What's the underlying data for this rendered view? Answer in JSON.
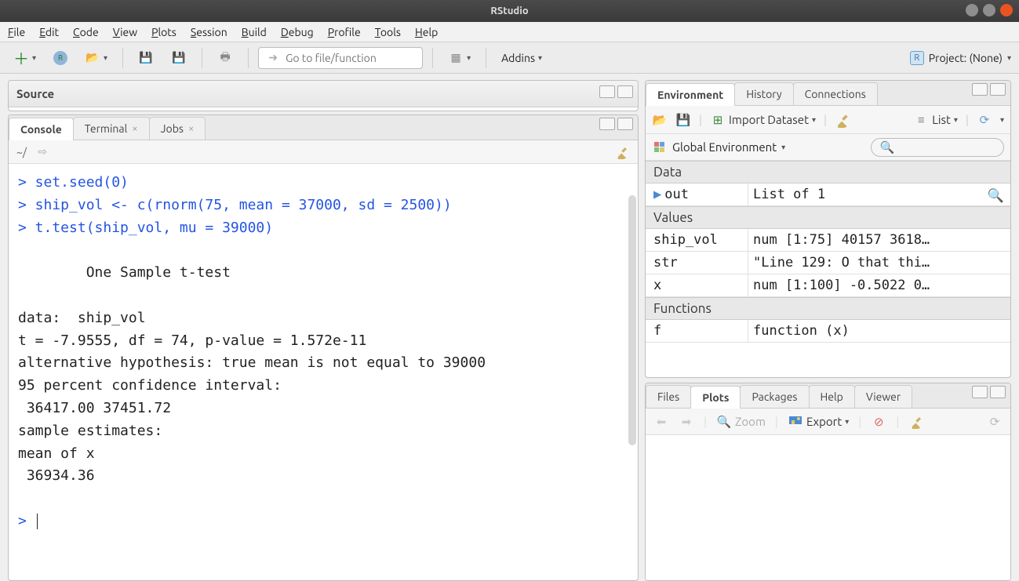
{
  "window": {
    "title": "RStudio"
  },
  "menubar": [
    "File",
    "Edit",
    "Code",
    "View",
    "Plots",
    "Session",
    "Build",
    "Debug",
    "Profile",
    "Tools",
    "Help"
  ],
  "toolbar": {
    "goto_placeholder": "Go to file/function",
    "addins_label": "Addins",
    "project_label": "Project: (None)"
  },
  "source_panel": {
    "title": "Source"
  },
  "console_panel": {
    "tabs": [
      {
        "label": "Console",
        "active": true,
        "closable": false
      },
      {
        "label": "Terminal",
        "active": false,
        "closable": true
      },
      {
        "label": "Jobs",
        "active": false,
        "closable": true
      }
    ],
    "cwd": "~/",
    "lines": [
      {
        "type": "cmd",
        "text": "> set.seed(0)"
      },
      {
        "type": "cmd",
        "text": "> ship_vol <- c(rnorm(75, mean = 37000, sd = 2500))"
      },
      {
        "type": "cmd",
        "text": "> t.test(ship_vol, mu = 39000)"
      },
      {
        "type": "out",
        "text": ""
      },
      {
        "type": "out",
        "text": "        One Sample t-test"
      },
      {
        "type": "out",
        "text": ""
      },
      {
        "type": "out",
        "text": "data:  ship_vol"
      },
      {
        "type": "out",
        "text": "t = -7.9555, df = 74, p-value = 1.572e-11"
      },
      {
        "type": "out",
        "text": "alternative hypothesis: true mean is not equal to 39000"
      },
      {
        "type": "out",
        "text": "95 percent confidence interval:"
      },
      {
        "type": "out",
        "text": " 36417.00 37451.72"
      },
      {
        "type": "out",
        "text": "sample estimates:"
      },
      {
        "type": "out",
        "text": "mean of x"
      },
      {
        "type": "out",
        "text": " 36934.36"
      },
      {
        "type": "out",
        "text": ""
      },
      {
        "type": "cmd",
        "text": "> "
      }
    ]
  },
  "env_panel": {
    "tabs": [
      {
        "label": "Environment",
        "active": true
      },
      {
        "label": "History",
        "active": false
      },
      {
        "label": "Connections",
        "active": false
      }
    ],
    "import_label": "Import Dataset",
    "view_label": "List",
    "scope_label": "Global Environment",
    "sections": [
      {
        "title": "Data",
        "rows": [
          {
            "name": "out",
            "value": "List of 1",
            "expandable": true,
            "searchable": true
          }
        ]
      },
      {
        "title": "Values",
        "rows": [
          {
            "name": "ship_vol",
            "value": "num [1:75] 40157 3618…"
          },
          {
            "name": "str",
            "value": "\"Line 129: O that thi…"
          },
          {
            "name": "x",
            "value": "num [1:100] -0.5022 0…"
          }
        ]
      },
      {
        "title": "Functions",
        "rows": [
          {
            "name": "f",
            "value": "function (x)"
          }
        ]
      }
    ]
  },
  "br_panel": {
    "tabs": [
      {
        "label": "Files",
        "active": false
      },
      {
        "label": "Plots",
        "active": true
      },
      {
        "label": "Packages",
        "active": false
      },
      {
        "label": "Help",
        "active": false
      },
      {
        "label": "Viewer",
        "active": false
      }
    ],
    "zoom_label": "Zoom",
    "export_label": "Export"
  }
}
